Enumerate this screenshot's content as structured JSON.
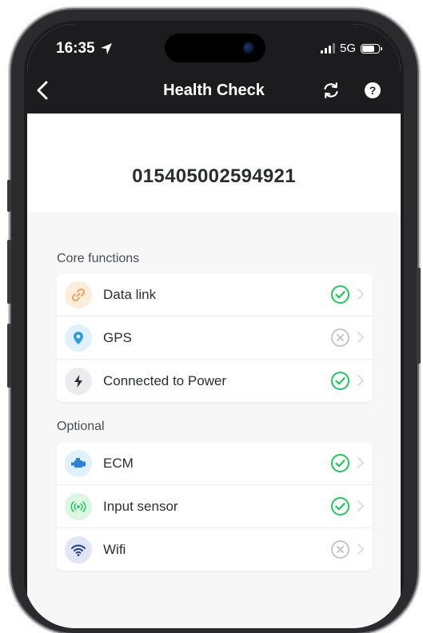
{
  "status_bar": {
    "time": "16:35",
    "network": "5G"
  },
  "nav": {
    "title": "Health Check"
  },
  "device": {
    "id": "015405002594921"
  },
  "sections": [
    {
      "label": "Core functions",
      "items": [
        {
          "label": "Data link",
          "icon": "link-icon",
          "status": "ok"
        },
        {
          "label": "GPS",
          "icon": "location-pin-icon",
          "status": "fail"
        },
        {
          "label": "Connected to Power",
          "icon": "lightning-bolt-icon",
          "status": "ok"
        }
      ]
    },
    {
      "label": "Optional",
      "items": [
        {
          "label": "ECM",
          "icon": "engine-icon",
          "status": "ok"
        },
        {
          "label": "Input sensor",
          "icon": "sensor-signal-icon",
          "status": "ok"
        },
        {
          "label": "Wifi",
          "icon": "wifi-icon",
          "status": "fail"
        }
      ]
    }
  ],
  "colors": {
    "ok": "#22c55e",
    "fail": "#c4c6cb",
    "header": "#1c1c1e"
  }
}
